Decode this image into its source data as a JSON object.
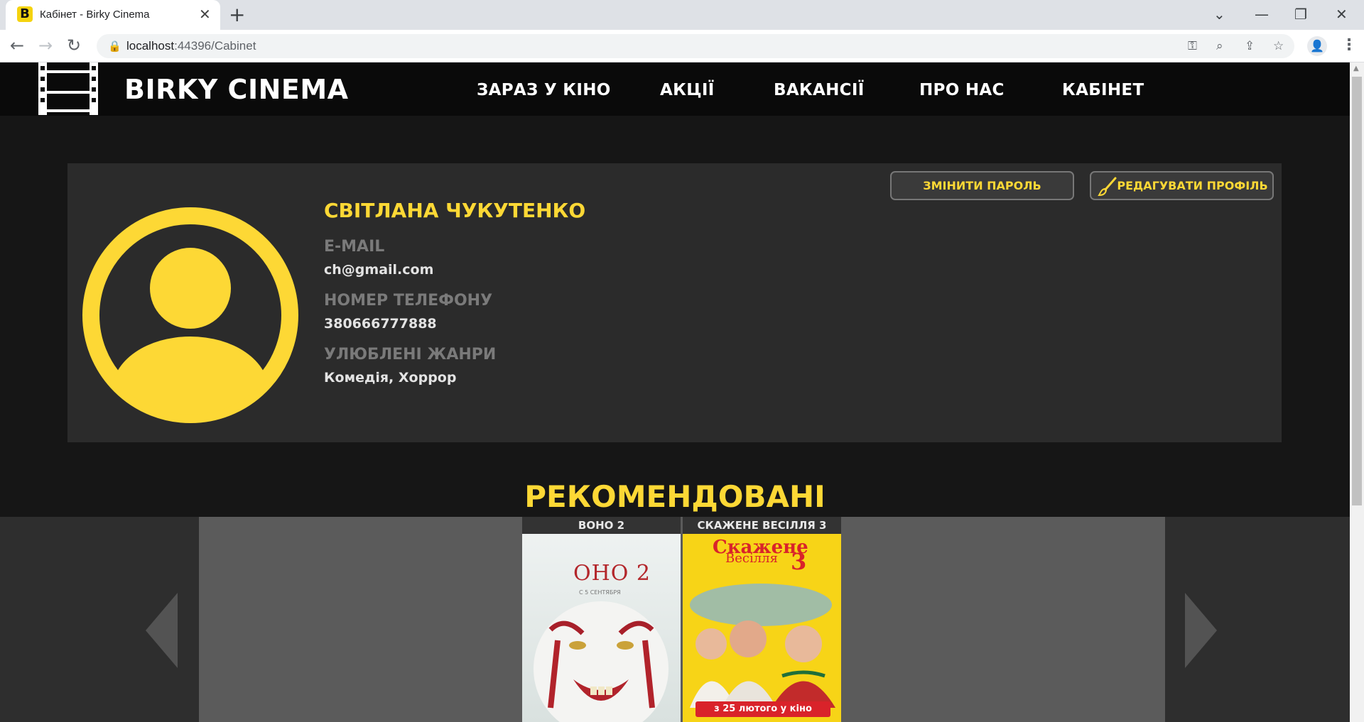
{
  "browser": {
    "tab_title": "Кабінет - Birky Cinema",
    "favicon_letter": "B",
    "url_host": "localhost",
    "url_path": ":44396/Cabinet"
  },
  "site": {
    "brand": "BIRKY CINEMA",
    "nav": [
      "ЗАРАЗ У КІНО",
      "АКЦІЇ",
      "ВАКАНСІЇ",
      "ПРО НАС",
      "КАБІНЕТ"
    ]
  },
  "profile": {
    "name": "СВІТЛАНА ЧУКУТЕНКО",
    "email_label": "E-MAIL",
    "email": "ch@gmail.com",
    "phone_label": "НОМЕР ТЕЛЕФОНУ",
    "phone": "380666777888",
    "genres_label": "УЛЮБЛЕНІ ЖАНРИ",
    "genres": "Комедія, Хоррор",
    "change_password": "ЗМІНИТИ ПАРОЛЬ",
    "edit_profile": "РЕДАГУВАТИ ПРОФІЛЬ"
  },
  "recommended": {
    "title": "РЕКОМЕНДОВАНІ",
    "movies": [
      {
        "title": "ВОНО 2",
        "poster_text": "ОНО 2",
        "poster_subtext": "С 5 СЕНТЯБРЯ"
      },
      {
        "title": "СКАЖЕНЕ ВЕСІЛЛЯ 3",
        "poster_text": "Скажене",
        "poster_text2": "Весілля",
        "poster_number": "3",
        "poster_subtext": "з 25 лютого у кіно"
      }
    ]
  },
  "colors": {
    "accent": "#fdd835",
    "header": "#0a0a0a",
    "card": "#2b2b2b"
  }
}
